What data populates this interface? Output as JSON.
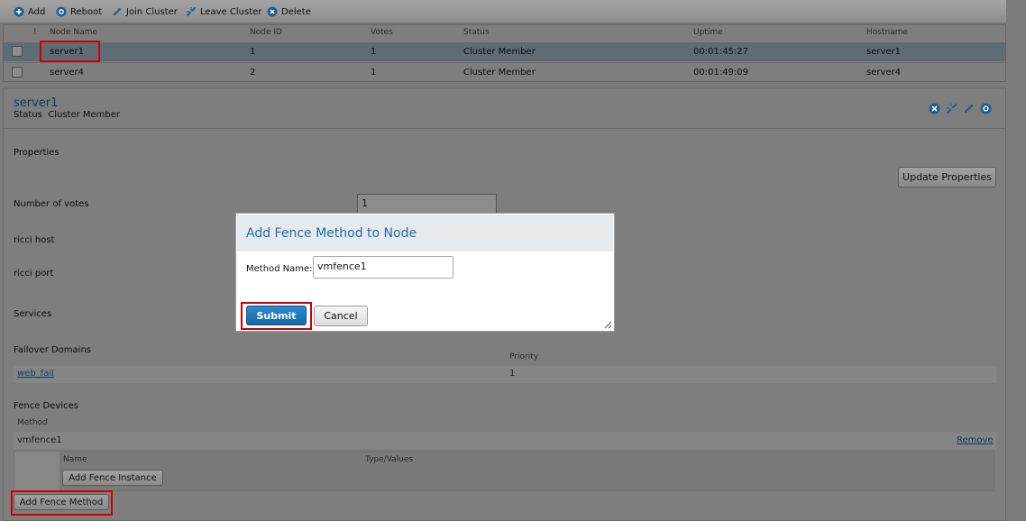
{
  "toolbar": {
    "items": [
      {
        "label": "Add",
        "icon": "plus-circle-icon"
      },
      {
        "label": "Reboot",
        "icon": "gear-icon"
      },
      {
        "label": "Join Cluster",
        "icon": "link-icon"
      },
      {
        "label": "Leave Cluster",
        "icon": "leave-cluster-icon"
      },
      {
        "label": "Delete",
        "icon": "x-circle-icon"
      }
    ]
  },
  "nodes": {
    "columns": [
      "!",
      "Node Name",
      "Node ID",
      "Votes",
      "Status",
      "Uptime",
      "Hostname"
    ],
    "rows": [
      {
        "name": "server1",
        "id": "1",
        "votes": "1",
        "status": "Cluster Member",
        "uptime": "00:01:45:27",
        "hostname": "server1"
      },
      {
        "name": "server4",
        "id": "2",
        "votes": "1",
        "status": "Cluster Member",
        "uptime": "00:01:49:09",
        "hostname": "server4"
      }
    ]
  },
  "details": {
    "title": "server1",
    "status_label": "Status",
    "status_value": "Cluster Member",
    "properties_label": "Properties",
    "update_button": "Update Properties",
    "votes_label": "Number of votes",
    "votes_value": "1",
    "ricci_host_label": "ricci host",
    "ricci_port_label": "ricci port",
    "services_label": "Services",
    "failover_label": "Failover Domains",
    "priority_header": "Priority",
    "failover_domain": "web_fail",
    "failover_priority": "1",
    "fence_devices_label": "Fence Devices",
    "method_header": "Method",
    "method_name": "vmfence1",
    "remove_link": "Remove",
    "instance_name_header": "Name",
    "instance_type_header": "Type/Values",
    "add_instance_button": "Add Fence Instance",
    "add_method_button": "Add Fence Method"
  },
  "modal": {
    "title": "Add Fence Method to Node",
    "field_label": "Method Name:",
    "field_value": "vmfence1",
    "submit": "Submit",
    "cancel": "Cancel"
  },
  "colors": {
    "accent": "#1b6fad",
    "highlight": "#d00000"
  }
}
